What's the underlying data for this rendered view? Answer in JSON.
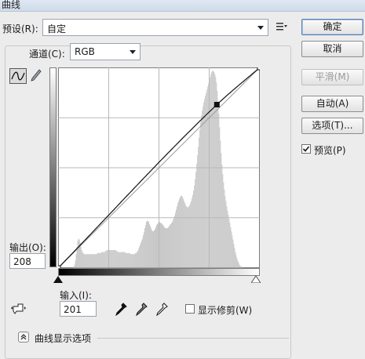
{
  "window": {
    "title": "曲线"
  },
  "preset": {
    "label": "预设(R):",
    "value": "自定"
  },
  "channel": {
    "label": "通道(C):",
    "value": "RGB"
  },
  "buttons": {
    "ok": "确定",
    "cancel": "取消",
    "smooth": "平滑(M)",
    "auto": "自动(A)",
    "options": "选项(T)..."
  },
  "preview": {
    "label": "预览(P)",
    "checked": true
  },
  "output": {
    "label": "输出(O):",
    "value": "208"
  },
  "input": {
    "label": "输入(I):",
    "value": "201"
  },
  "show_clipping": {
    "label": "显示修剪(W)",
    "checked": false
  },
  "curve_display_options": {
    "label": "曲线显示选项"
  },
  "icons": [
    "curve-tool-icon",
    "pencil-icon",
    "preset-menu-icon",
    "targeted-adjust-icon",
    "black-eyedropper-icon",
    "gray-eyedropper-icon",
    "white-eyedropper-icon",
    "expand-options-icon"
  ],
  "curve": {
    "points": [
      {
        "input": 0,
        "output": 0
      },
      {
        "input": 201,
        "output": 208
      },
      {
        "input": 255,
        "output": 255
      }
    ],
    "selected_point": {
      "input": 201,
      "output": 208
    }
  },
  "histogram": [
    0,
    0,
    0,
    0,
    0,
    0,
    0,
    0,
    0,
    0,
    0,
    0,
    0,
    0,
    0,
    0,
    0,
    0,
    0,
    1,
    3,
    7,
    13,
    20,
    26,
    28,
    27,
    24,
    20,
    17,
    15,
    14,
    13,
    13,
    13,
    13,
    13,
    13,
    13,
    13,
    13,
    13,
    13,
    13,
    13,
    13,
    13,
    13,
    13,
    14,
    14,
    14,
    14,
    14,
    15,
    15,
    15,
    15,
    15,
    16,
    16,
    17,
    17,
    17,
    17,
    17,
    17,
    17,
    17,
    17,
    17,
    17,
    17,
    16,
    16,
    15,
    15,
    15,
    15,
    15,
    15,
    15,
    15,
    15,
    15,
    14,
    14,
    14,
    14,
    14,
    14,
    13,
    13,
    13,
    13,
    13,
    13,
    14,
    14,
    15,
    16,
    18,
    20,
    22,
    24,
    26,
    28,
    31,
    34,
    38,
    41,
    44,
    45,
    45,
    44,
    42,
    40,
    38,
    36,
    35,
    35,
    36,
    37,
    39,
    41,
    42,
    43,
    44,
    44,
    43,
    43,
    42,
    41,
    40,
    39,
    38,
    38,
    38,
    38,
    39,
    40,
    41,
    42,
    43,
    44,
    46,
    48,
    50,
    53,
    56,
    59,
    62,
    64,
    66,
    68,
    69,
    69,
    68,
    66,
    64,
    62,
    60,
    59,
    58,
    58,
    59,
    60,
    62,
    64,
    67,
    70,
    74,
    79,
    85,
    92,
    100,
    108,
    116,
    125,
    133,
    140,
    146,
    151,
    155,
    159,
    162,
    165,
    168,
    171,
    174,
    177,
    180,
    183,
    186,
    188,
    189,
    189,
    188,
    186,
    183,
    178,
    170,
    160,
    148,
    135,
    122,
    110,
    99,
    90,
    82,
    75,
    69,
    64,
    59,
    55,
    51,
    47,
    43,
    39,
    35,
    31,
    27,
    23,
    19,
    15,
    12,
    9,
    7,
    5,
    3,
    2,
    1,
    1,
    0,
    0,
    0,
    0,
    0,
    0,
    0,
    0,
    0,
    0,
    0,
    0,
    0,
    0,
    0,
    0,
    0,
    0,
    0,
    0,
    0,
    0,
    0,
    0,
    0,
    0,
    0,
    0,
    0,
    0,
    0,
    0,
    0,
    0,
    0,
    0,
    0,
    0,
    0,
    0,
    0
  ],
  "colors": {
    "histogram": "#c8c8c8",
    "curve": "#111111",
    "baseline": "#9a9a9a",
    "grid": "#b8b8b8"
  }
}
